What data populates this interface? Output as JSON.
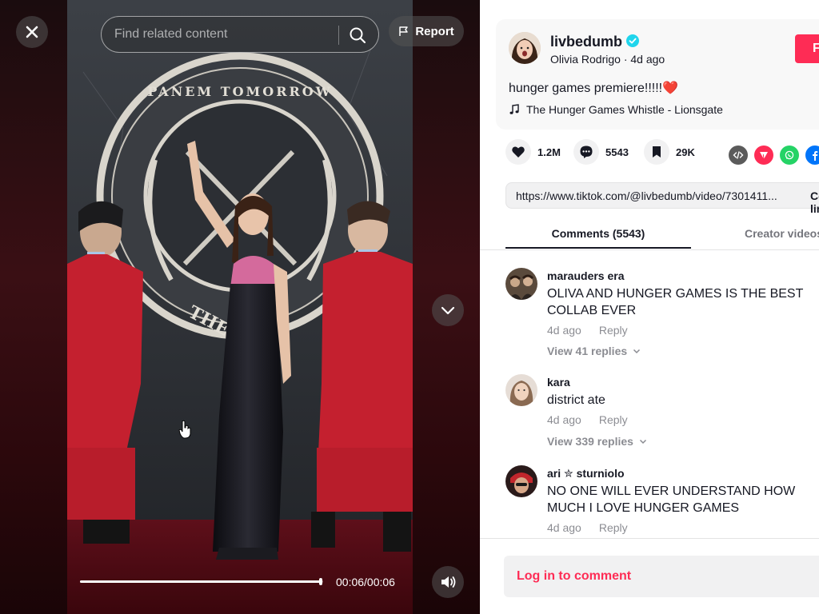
{
  "search": {
    "placeholder": "Find related content"
  },
  "report": {
    "label": "Report"
  },
  "player": {
    "time": "00:06/00:06",
    "progress_fraction": 0.99
  },
  "author": {
    "username": "livbedumb",
    "display_name": "Olivia Rodrigo",
    "separator": " · ",
    "posted_ago": "4d ago",
    "follow_label": "Follow"
  },
  "post": {
    "caption": "hunger games premiere!!!!!",
    "caption_emoji": "❤️",
    "music": "The Hunger Games Whistle - Lionsgate"
  },
  "actions": {
    "likes": "1.2M",
    "comments": "5543",
    "saves": "29K"
  },
  "share": {
    "icons": [
      "embed-icon",
      "send-icon",
      "whatsapp-icon",
      "facebook-icon"
    ],
    "colors": {
      "embed": "#5b5b5b",
      "send": "#fe2c55",
      "whatsapp": "#25d366",
      "facebook": "#0075fa"
    }
  },
  "link": {
    "url": "https://www.tiktok.com/@livbedumb/video/7301411...",
    "copy_label": "Copy link"
  },
  "tabs": [
    {
      "label": "Comments (5543)",
      "active": true
    },
    {
      "label": "Creator videos",
      "active": false
    }
  ],
  "comments": [
    {
      "name": "marauders era",
      "text": "OLIVA AND HUNGER GAMES IS THE BEST COLLAB EVER",
      "ago": "4d ago",
      "reply": "Reply",
      "replies": "View 41 replies"
    },
    {
      "name": "kara",
      "text": "district ate",
      "ago": "4d ago",
      "reply": "Reply",
      "replies": "View 339 replies"
    },
    {
      "name": "ari ✮ sturniolo",
      "text": "NO ONE WILL EVER UNDERSTAND HOW MUCH I LOVE HUNGER GAMES",
      "ago": "4d ago",
      "reply": "Reply"
    }
  ],
  "bottom": {
    "login_label": "Log in to comment"
  },
  "colors": {
    "accent": "#fe2c55",
    "verified": "#20d5ec"
  }
}
